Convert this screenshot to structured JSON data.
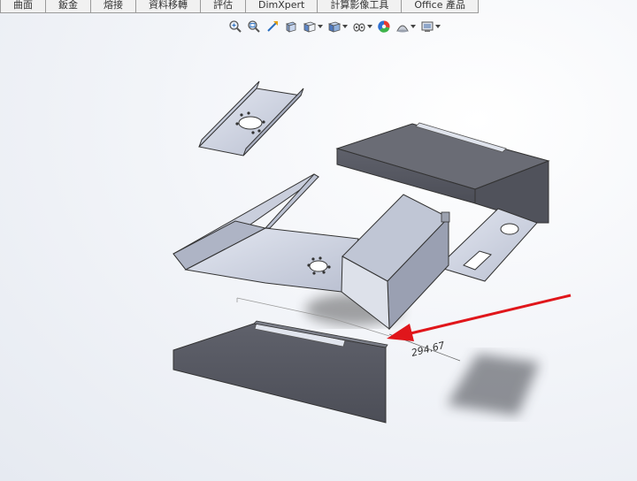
{
  "tabs": [
    {
      "label": "曲面"
    },
    {
      "label": "鈑金"
    },
    {
      "label": "熔接"
    },
    {
      "label": "資料移轉"
    },
    {
      "label": "評估"
    },
    {
      "label": "DimXpert"
    },
    {
      "label": "計算影像工具"
    },
    {
      "label": "Office 產品"
    }
  ],
  "heads_up_toolbar": {
    "icons": [
      "zoom-to-fit-icon",
      "zoom-area-icon",
      "previous-view-icon",
      "section-view-icon",
      "view-orientation-icon",
      "display-style-icon",
      "hide-show-icon",
      "edit-appearance-icon",
      "apply-scene-icon",
      "view-settings-icon"
    ]
  },
  "dimension": {
    "value": "294.67"
  },
  "colors": {
    "panel_dark": "#5b5d66",
    "sheet_light": "#d3d8e6",
    "arrow": "#e0161b"
  }
}
